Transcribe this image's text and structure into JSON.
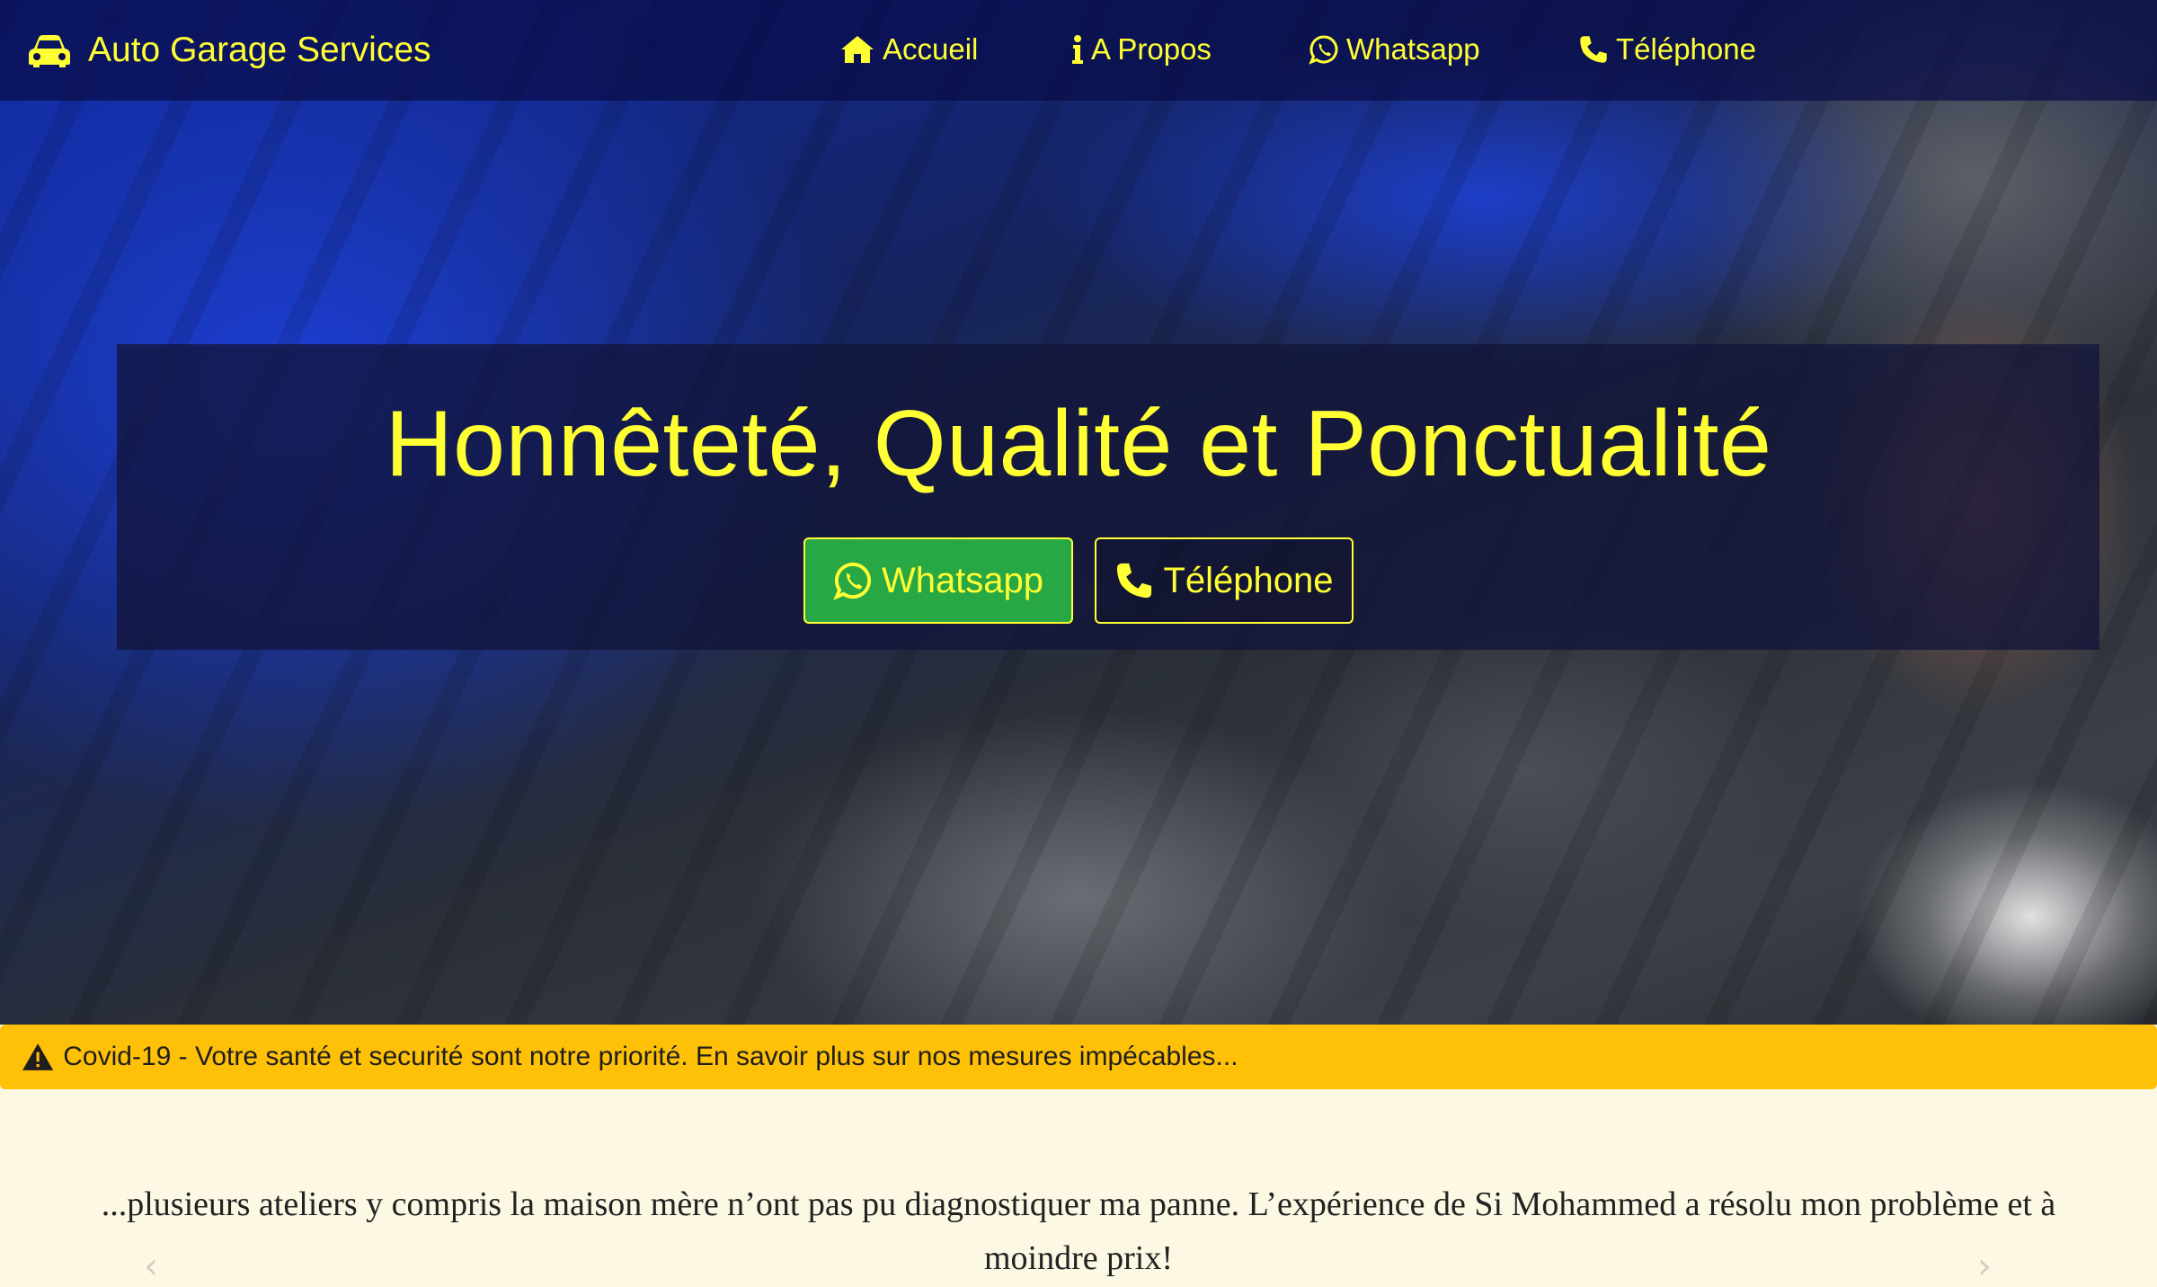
{
  "navbar": {
    "brand": "Auto Garage Services",
    "items": [
      {
        "label": "Accueil",
        "icon": "home-icon"
      },
      {
        "label": "A Propos",
        "icon": "info-icon"
      },
      {
        "label": "Whatsapp",
        "icon": "whatsapp-icon"
      },
      {
        "label": "Téléphone",
        "icon": "phone-icon"
      }
    ]
  },
  "hero": {
    "headline": "Honnêteté, Qualité et Ponctualité",
    "whatsapp_button": "Whatsapp",
    "phone_button": "Téléphone"
  },
  "alert": {
    "icon": "warning-icon",
    "text": "Covid-19 - Votre santé et securité sont notre priorité. En savoir plus sur nos mesures impécables..."
  },
  "testimonial": {
    "text": "...plusieurs ateliers y compris la maison mère n’ont pas pu diagnostiquer ma panne. L’expérience de Si Mohammed a résolu mon problème et à moindre prix!"
  },
  "colors": {
    "accent": "#ffff33",
    "whatsapp_green": "#28a745",
    "alert_yellow": "#ffc107",
    "page_background": "#fdf8e4"
  }
}
